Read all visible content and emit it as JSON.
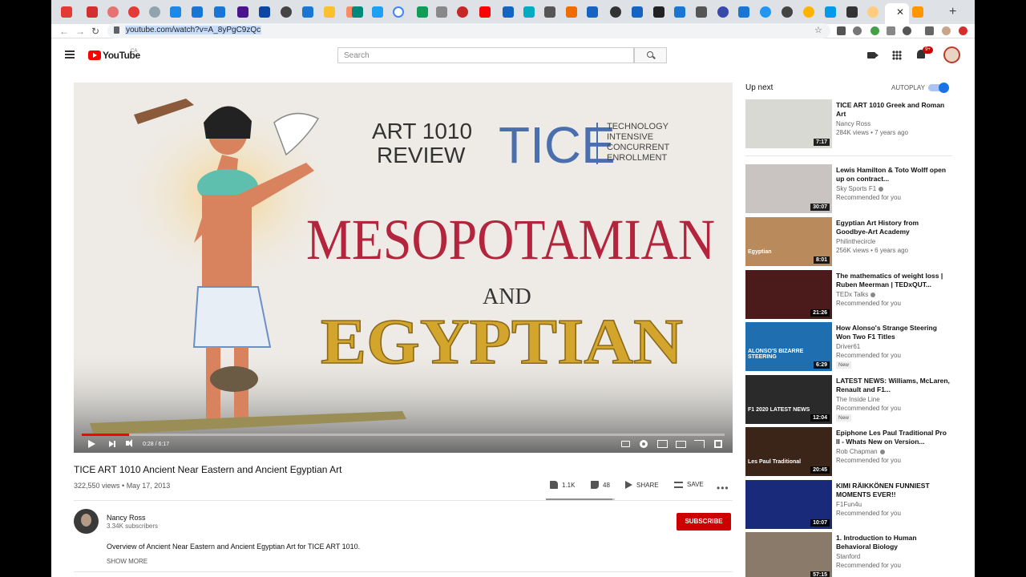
{
  "browser": {
    "url": "youtube.com/watch?v=A_8yPgC9zQc"
  },
  "youtube": {
    "logo_text": "YouTube",
    "country": "CA",
    "search_placeholder": "Search",
    "notification_count": "9+"
  },
  "player": {
    "time": "0:28 / 6:17",
    "progress_fraction": 0.074
  },
  "video": {
    "title": "TICE ART 1010 Ancient Near Eastern and Ancient Egyptian Art",
    "stats": "322,550 views • May 17, 2013",
    "likes": "1.1K",
    "dislikes": "48",
    "like_ratio": 0.96,
    "share_label": "SHARE",
    "save_label": "SAVE",
    "channel_name": "Nancy Ross",
    "subscribers": "3.34K subscribers",
    "subscribe_label": "SUBSCRIBE",
    "description": "Overview of Ancient Near Eastern and Ancient Egyptian Art for TICE ART 1010.",
    "show_more": "SHOW MORE"
  },
  "artwork": {
    "line1": "ART 1010",
    "line2": "REVIEW",
    "tice": "TICE",
    "sub1": "TECHNOLOGY",
    "sub2": "INTENSIVE",
    "sub3": "CONCURRENT",
    "sub4": "ENROLLMENT",
    "word1": "MESOPOTAMIAN",
    "word2": "AND",
    "word3": "EGYPTIAN"
  },
  "sidebar": {
    "upnext": "Up next",
    "autoplay": "AUTOPLAY",
    "items": [
      {
        "title": "TICE ART 1010 Greek and Roman Art",
        "channel": "Nancy Ross",
        "meta": "284K views • 7 years ago",
        "duration": "7:17",
        "thumb": "#d9d9d4",
        "verified": false,
        "badge": "",
        "caption": ""
      },
      {
        "title": "Lewis Hamilton & Toto Wolff open up on contract...",
        "channel": "Sky Sports F1",
        "meta": "Recommended for you",
        "duration": "30:07",
        "thumb": "#c9c4c2",
        "verified": true,
        "badge": "",
        "caption": ""
      },
      {
        "title": "Egyptian Art History from Goodbye-Art Academy",
        "channel": "Philinthecircle",
        "meta": "256K views • 6 years ago",
        "duration": "8:01",
        "thumb": "#b98a5b",
        "verified": false,
        "badge": "",
        "caption": "Egyptian"
      },
      {
        "title": "The mathematics of weight loss | Ruben Meerman | TEDxQUT...",
        "channel": "TEDx Talks",
        "meta": "Recommended for you",
        "duration": "21:26",
        "thumb": "#4b1a1a",
        "verified": true,
        "badge": "",
        "caption": ""
      },
      {
        "title": "How Alonso's Strange Steering Won Two F1 Titles",
        "channel": "Driver61",
        "meta": "Recommended for you",
        "duration": "6:29",
        "thumb": "#1f6fb0",
        "verified": false,
        "badge": "New",
        "caption": "ALONSO'S BIZARRE STEERING"
      },
      {
        "title": "LATEST NEWS: Williams, McLaren, Renault and F1...",
        "channel": "The Inside Line",
        "meta": "Recommended for you",
        "duration": "12:04",
        "thumb": "#2a2a2a",
        "verified": false,
        "badge": "New",
        "caption": "F1 2020 LATEST NEWS"
      },
      {
        "title": "Epiphone Les Paul Traditional Pro II - Whats New on Version...",
        "channel": "Rob Chapman",
        "meta": "Recommended for you",
        "duration": "20:45",
        "thumb": "#3b2418",
        "verified": true,
        "badge": "",
        "caption": "Les Paul Traditional"
      },
      {
        "title": "KIMI RÄIKKÖNEN FUNNIEST MOMENTS EVER!!",
        "channel": "F1Fun4u",
        "meta": "Recommended for you",
        "duration": "10:07",
        "thumb": "#1a2a7a",
        "verified": false,
        "badge": "",
        "caption": ""
      },
      {
        "title": "1. Introduction to Human Behavioral Biology",
        "channel": "Stanford",
        "meta": "Recommended for you",
        "duration": "57:15",
        "thumb": "#8a7a6a",
        "verified": false,
        "badge": "",
        "caption": ""
      }
    ]
  }
}
